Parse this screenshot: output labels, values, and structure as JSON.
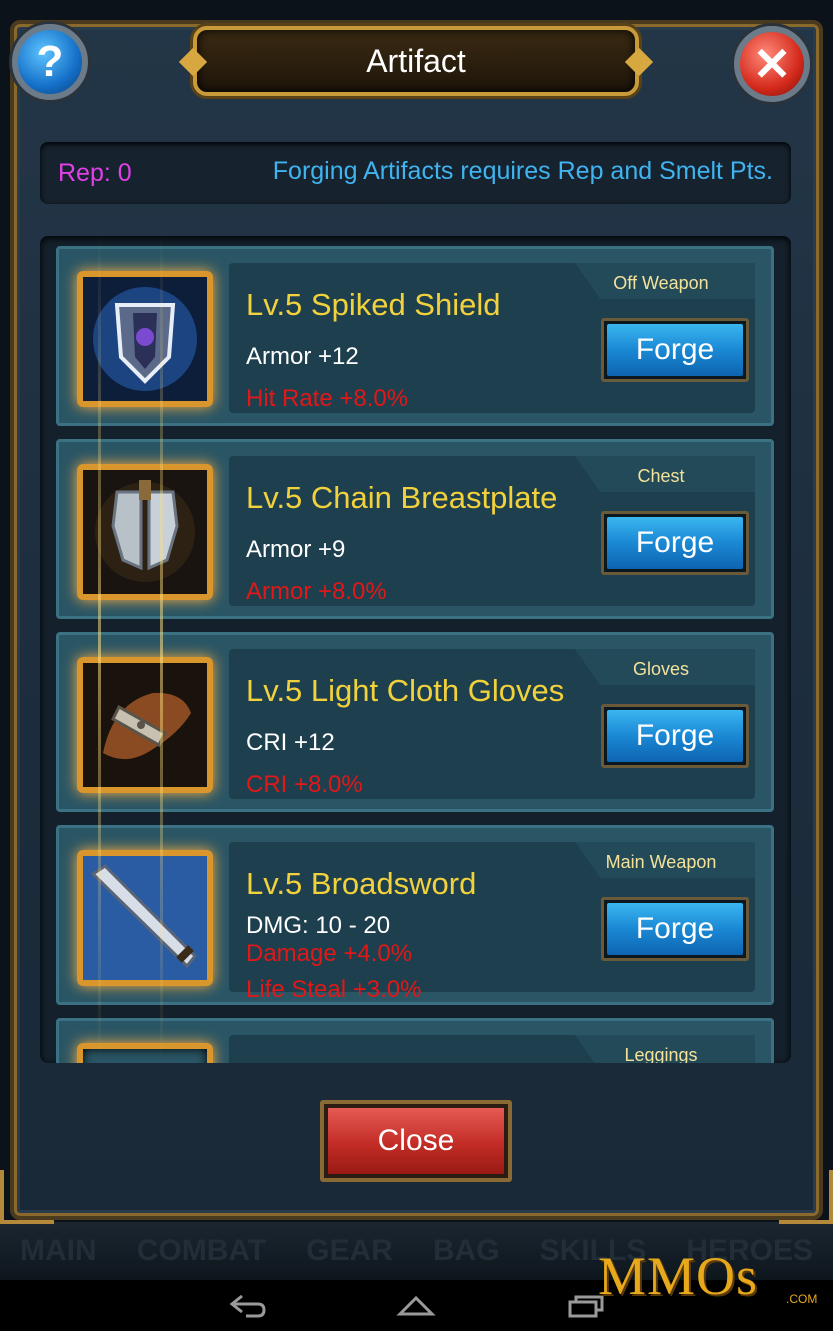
{
  "dialog": {
    "title": "Artifact",
    "help_icon": "question-icon",
    "close_icon": "close-x-icon",
    "help_label": "?",
    "close_label": "✕"
  },
  "rep_bar": {
    "rep": "Rep: 0",
    "note": "Forging Artifacts requires Rep and Smelt Pts."
  },
  "items": [
    {
      "slot": "Off Weapon",
      "name": "Lv.5 Spiked Shield",
      "stats": [
        "Armor +12"
      ],
      "bonuses": [
        "Hit Rate +8.0%"
      ],
      "forge_label": "Forge",
      "icon": "shield-icon"
    },
    {
      "slot": "Chest",
      "name": "Lv.5 Chain Breastplate",
      "stats": [
        "Armor +9"
      ],
      "bonuses": [
        "Armor +8.0%"
      ],
      "forge_label": "Forge",
      "icon": "breastplate-icon"
    },
    {
      "slot": "Gloves",
      "name": "Lv.5 Light Cloth Gloves",
      "stats": [
        "CRI +12"
      ],
      "bonuses": [
        "CRI +8.0%"
      ],
      "forge_label": "Forge",
      "icon": "gloves-icon"
    },
    {
      "slot": "Main Weapon",
      "name": "Lv.5 Broadsword",
      "stats": [
        "DMG: 10 - 20"
      ],
      "bonuses": [
        "Damage +4.0%",
        "Life Steal +3.0%"
      ],
      "forge_label": "Forge",
      "icon": "sword-icon"
    },
    {
      "slot": "Leggings",
      "name": "",
      "stats": [],
      "bonuses": [],
      "forge_label": "",
      "icon": "leggings-icon"
    }
  ],
  "close_button": "Close",
  "background_nav": [
    "MAIN",
    "COMBAT",
    "GEAR",
    "BAG",
    "SKILLS",
    "HEROES"
  ],
  "system_nav": {
    "back_icon": "back-icon",
    "home_icon": "home-icon",
    "recents_icon": "recents-icon"
  },
  "watermark": {
    "text": "MMOs",
    "suffix": ".COM"
  },
  "colors": {
    "title_gold": "#f2d23c",
    "rep_magenta": "#e040e8",
    "note_blue": "#3fb4f0",
    "bonus_red": "#e01818",
    "forge_blue": "#1a88d4",
    "close_red": "#c22c26"
  }
}
